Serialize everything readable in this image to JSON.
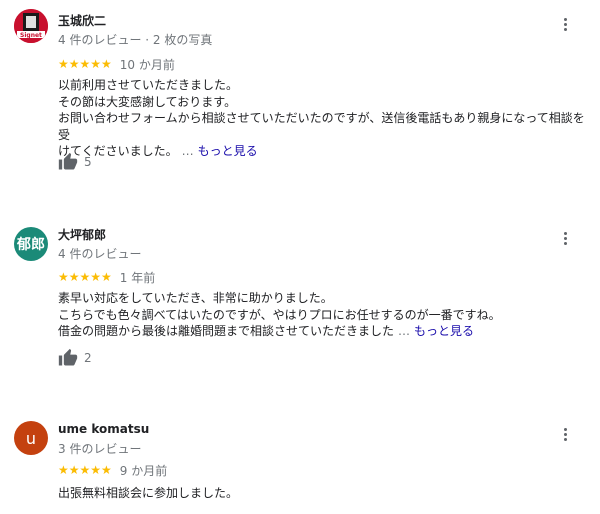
{
  "reviews": [
    {
      "name": "玉城欣二",
      "meta": "4 件のレビュー · 2 枚の写真",
      "stars": "★★★★★",
      "date": "10 か月前",
      "lines": [
        "以前利用させていただきました。",
        "その節は大変感謝しております。",
        "お問い合わせフォームから相談させていただいたのですが、送信後電話もあり親身になって相談を受",
        "けてくださいました。"
      ],
      "ellipsis": "…",
      "more": "もっと見る",
      "likes": "5",
      "avatar_label": "Signet"
    },
    {
      "name": "大坪郁郎",
      "meta": "4 件のレビュー",
      "stars": "★★★★★",
      "date": "1 年前",
      "lines": [
        "素早い対応をしていただき、非常に助かりました。",
        "こちらでも色々調べてはいたのですが、やはりプロにお任せするのが一番ですね。",
        "借金の問題から最後は離婚問題まで相談させていただきました"
      ],
      "ellipsis": "…",
      "more": "もっと見る",
      "likes": "2",
      "avatar_text": "郁郎"
    },
    {
      "name": "ume komatsu",
      "meta": "3 件のレビュー",
      "stars": "★★★★★",
      "date": "9 か月前",
      "lines": [
        "出張無料相談会に参加しました。"
      ],
      "avatar_text": "u"
    }
  ],
  "colors": {
    "star": "#fbbc04",
    "link": "#1a0dab",
    "avatar2": "#1b8a78",
    "avatar3": "#c4410f",
    "avatar1": "#c8102e"
  },
  "icons": [
    "thumb-up-icon",
    "more-vert-icon"
  ]
}
